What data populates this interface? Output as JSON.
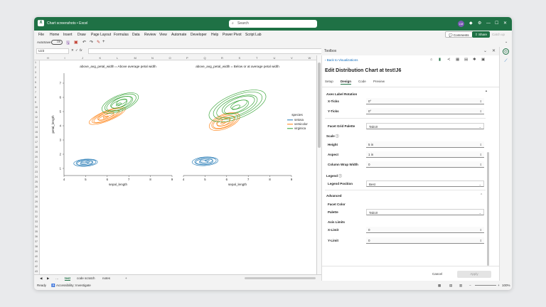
{
  "titlebar": {
    "app_icon": "X",
    "title": "Chart screenshots • Excel",
    "search": "Search",
    "avatar": "LM"
  },
  "menu": {
    "items": [
      "File",
      "Home",
      "Insert",
      "Draw",
      "Page Layout",
      "Formulas",
      "Data",
      "Review",
      "View",
      "Automate",
      "Developer",
      "Help",
      "Power Pivot",
      "Script Lab"
    ],
    "comments": "Comments",
    "share": "Share",
    "catchup": "Catch up"
  },
  "qat": {
    "autosave": "AutoSave",
    "toggle": "Off"
  },
  "formula": {
    "cell": "U23",
    "fx": "fx"
  },
  "columns": [
    "H",
    "I",
    "J",
    "K",
    "L",
    "M",
    "N",
    "O",
    "P",
    "Q",
    "R",
    "S",
    "T",
    "U",
    "V",
    "W"
  ],
  "rows": [
    "1",
    "2",
    "3",
    "4",
    "5",
    "6",
    "7",
    "8",
    "9",
    "10",
    "11",
    "12",
    "13",
    "14",
    "15",
    "16",
    "17",
    "18",
    "19",
    "20",
    "21",
    "22",
    "23",
    "24",
    "25",
    "26",
    "27",
    "28",
    "29",
    "30",
    "31",
    "32",
    "33",
    "34",
    "35",
    "36",
    "37",
    "38",
    "39",
    "40",
    "41",
    "42",
    "43"
  ],
  "sheet_tabs": {
    "items": [
      "test",
      "code scratch",
      "notes"
    ],
    "add": "+"
  },
  "statusbar": {
    "ready": "Ready",
    "accessibility": "Accessibility: Investigate",
    "zoom": "100%"
  },
  "pane": {
    "header": "Toolbox",
    "back": "Back to Visualizations",
    "title": "Edit Distribution Chart at test!J6",
    "tabs": [
      "Setup",
      "Design",
      "Code",
      "Preview"
    ],
    "active_tab": "Design",
    "axes_label_rotation": "Axes Label Rotation",
    "xticks_label": "X-Ticks",
    "xticks_value": "0°",
    "yticks_label": "Y-Ticks",
    "yticks_value": "0°",
    "facet_grid_palette_label": "Facet Grid Palette",
    "facet_grid_palette_value": "Tab10",
    "scale_section": "Scale",
    "height_label": "Height",
    "height_value": "5 in",
    "aspect_label": "Aspect",
    "aspect_value": "1 in",
    "col_wrap_label": "Column Wrap Width",
    "col_wrap_value": "0",
    "legend_section": "Legend",
    "legend_position_label": "Legend Position",
    "legend_position_value": "Best",
    "advanced_section": "Advanced",
    "facet_color_label": "Facet Color",
    "palette_label": "Palette",
    "palette_value": "Tab10",
    "axis_limits_label": "Axis Limits",
    "xlimit_label": "X-Limit",
    "xlimit_value": "0",
    "ylimit_label": "Y-Limit",
    "ylimit_value": "0",
    "cancel": "Cancel",
    "apply": "Apply"
  },
  "colors": {
    "excel_green": "#1f7145",
    "setosa": "#1f77b4",
    "versicolor": "#ff7f0e",
    "virginica": "#2ca02c"
  },
  "chart_data": {
    "type": "kde",
    "facets": [
      {
        "title": "above_avg_petal_width = Above average petal width"
      },
      {
        "title": "above_avg_petal_width = Below or at average petal width"
      }
    ],
    "xlabel": "sepal_length",
    "ylabel": "petal_length",
    "xticks": [
      4,
      5,
      6,
      7,
      8,
      9
    ],
    "yticks": [
      1,
      2,
      3,
      4,
      5,
      6,
      7
    ],
    "xlim": [
      4,
      9
    ],
    "ylim": [
      0.5,
      7.7
    ],
    "legend": {
      "title": "species",
      "entries": [
        "setosa",
        "versicolor",
        "virginica"
      ],
      "placement": "right"
    },
    "density_centers": [
      {
        "facet": 0,
        "series": "setosa",
        "x": 5.0,
        "y": 1.4,
        "sx": 0.55,
        "sy": 0.25,
        "levels": 6
      },
      {
        "facet": 0,
        "series": "versicolor",
        "x": 6.0,
        "y": 4.7,
        "sx": 0.9,
        "sy": 0.35,
        "levels": 7
      },
      {
        "facet": 0,
        "series": "virginica",
        "x": 6.6,
        "y": 5.6,
        "sx": 0.9,
        "sy": 0.55,
        "levels": 7
      },
      {
        "facet": 1,
        "series": "setosa",
        "x": 5.0,
        "y": 1.5,
        "sx": 0.6,
        "sy": 0.3,
        "levels": 6
      },
      {
        "facet": 1,
        "series": "versicolor",
        "x": 5.9,
        "y": 4.3,
        "sx": 0.75,
        "sy": 0.5,
        "levels": 7
      },
      {
        "facet": 1,
        "series": "virginica",
        "x": 6.5,
        "y": 5.4,
        "sx": 1.4,
        "sy": 0.85,
        "levels": 7
      }
    ]
  }
}
